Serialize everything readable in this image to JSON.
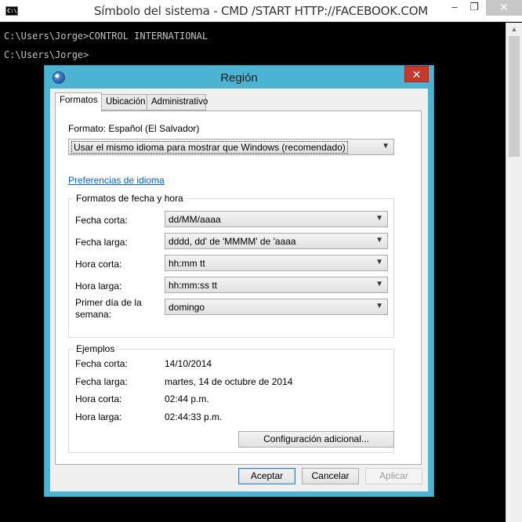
{
  "cmd": {
    "icon_text": "C:\\.",
    "title": "Símbolo del sistema - CMD  /START HTTP://FACEBOOK.COM",
    "lines": [
      "C:\\Users\\Jorge>CONTROL INTERNATIONAL",
      "C:\\Users\\Jorge>"
    ],
    "controls": {
      "minimize": "–",
      "maximize": "❐",
      "close": "✕"
    },
    "scroll_up": "▲"
  },
  "dialog": {
    "title": "Región",
    "close": "✕",
    "tabs": [
      "Formatos",
      "Ubicación",
      "Administrativo"
    ],
    "active_tab": "Formatos",
    "format_label": "Formato: Español (El Salvador)",
    "language_combo": "Usar el mismo idioma para mostrar que Windows (recomendado)",
    "language_prefs_link": "Preferencias de idioma",
    "date_time_group": {
      "title": "Formatos de fecha y hora",
      "rows": [
        {
          "label": "Fecha corta:",
          "value": "dd/MM/aaaa"
        },
        {
          "label": "Fecha larga:",
          "value": "dddd, dd' de 'MMMM' de 'aaaa"
        },
        {
          "label": "Hora corta:",
          "value": "hh:mm tt"
        },
        {
          "label": "Hora larga:",
          "value": "hh:mm:ss tt"
        },
        {
          "label_line1": "Primer día de la",
          "label_line2": "semana:",
          "value": "domingo"
        }
      ]
    },
    "examples_group": {
      "title": "Ejemplos",
      "rows": [
        {
          "label": "Fecha corta:",
          "value": "14/10/2014"
        },
        {
          "label": "Fecha larga:",
          "value": "martes, 14 de octubre de 2014"
        },
        {
          "label": "Hora corta:",
          "value": "02:44 p.m."
        },
        {
          "label": "Hora larga:",
          "value": "02:44:33 p.m."
        }
      ]
    },
    "additional_settings_button": "Configuración adicional...",
    "buttons": {
      "accept": "Aceptar",
      "cancel": "Cancelar",
      "apply": "Aplicar"
    },
    "dropdown_arrow": "▼"
  },
  "colors": {
    "dialog_frame": "#4ab4d2",
    "close_button": "#c8392c",
    "link": "#0066cc"
  }
}
